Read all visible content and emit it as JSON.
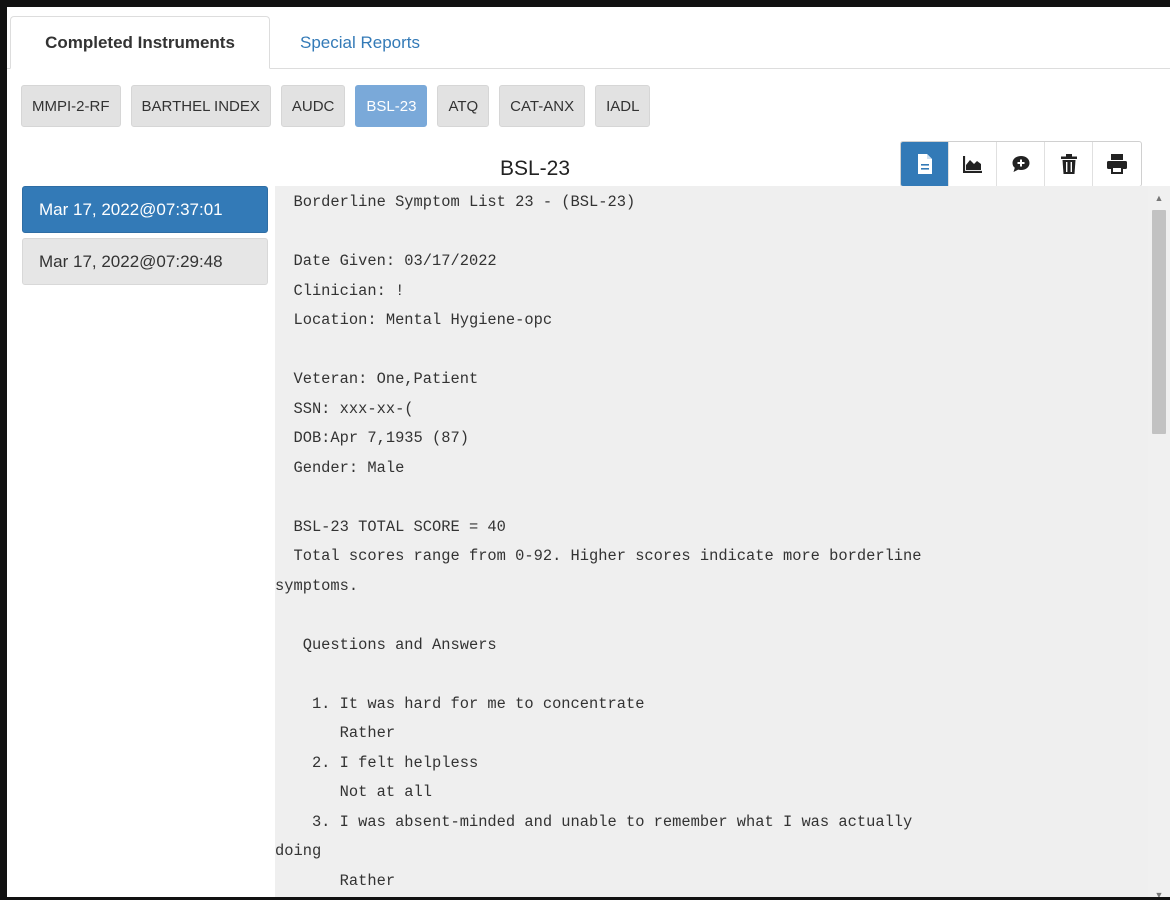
{
  "tabs": {
    "completed": "Completed Instruments",
    "special": "Special Reports"
  },
  "instruments": [
    "MMPI-2-RF",
    "BARTHEL INDEX",
    "AUDC",
    "BSL-23",
    "ATQ",
    "CAT-ANX",
    "IADL"
  ],
  "active_instrument": "BSL-23",
  "report_title": "BSL-23",
  "toolbar": {
    "icons": [
      "document-icon",
      "chart-icon",
      "comment-icon",
      "trash-icon",
      "print-icon"
    ],
    "accent": "#337ab7"
  },
  "dates": [
    "Mar 17, 2022@07:37:01",
    "Mar 17, 2022@07:29:48"
  ],
  "report_text": "  Borderline Symptom List 23 - (BSL-23)\n\n  Date Given: 03/17/2022\n  Clinician: !\n  Location: Mental Hygiene-opc\n\n  Veteran: One,Patient\n  SSN: xxx-xx-(\n  DOB:Apr 7,1935 (87)\n  Gender: Male\n\n  BSL-23 TOTAL SCORE = 40\n  Total scores range from 0-92. Higher scores indicate more borderline\nsymptoms.\n\n   Questions and Answers\n\n    1. It was hard for me to concentrate\n       Rather\n    2. I felt helpless\n       Not at all\n    3. I was absent-minded and unable to remember what I was actually\ndoing\n       Rather"
}
